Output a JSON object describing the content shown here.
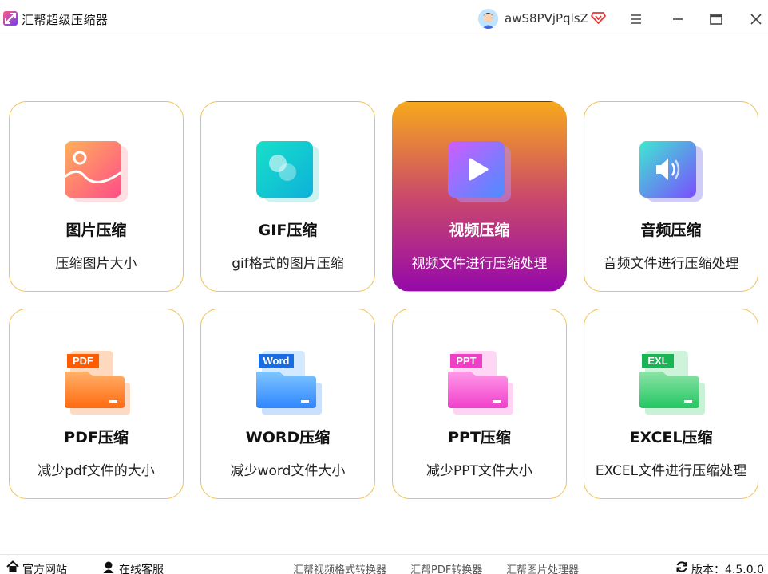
{
  "window": {
    "title": "汇帮超级压缩器",
    "username": "awS8PVjPqlsZ",
    "accent": "#f2c24f"
  },
  "cards": [
    {
      "title": "图片压缩",
      "desc": "压缩图片大小",
      "icon": "image-icon"
    },
    {
      "title": "GIF压缩",
      "desc": "gif格式的图片压缩",
      "icon": "gif-icon"
    },
    {
      "title": "视频压缩",
      "desc": "视频文件进行压缩处理",
      "icon": "video-play-icon",
      "selected": true
    },
    {
      "title": "音频压缩",
      "desc": "音频文件进行压缩处理",
      "icon": "speaker-icon"
    },
    {
      "title": "PDF压缩",
      "desc": "减少pdf文件的大小",
      "icon": "pdf-folder-icon",
      "tag": "PDF"
    },
    {
      "title": "WORD压缩",
      "desc": "减少word文件大小",
      "icon": "word-folder-icon",
      "tag": "Word"
    },
    {
      "title": "PPT压缩",
      "desc": "减少PPT文件大小",
      "icon": "ppt-folder-icon",
      "tag": "PPT"
    },
    {
      "title": "EXCEL压缩",
      "desc": "EXCEL文件进行压缩处理",
      "icon": "excel-folder-icon",
      "tag": "EXL"
    }
  ],
  "footer": {
    "website": "官方网站",
    "support": "在线客服",
    "links": [
      "汇帮视频格式转换器",
      "汇帮PDF转换器",
      "汇帮图片处理器"
    ],
    "version": "版本：4.5.0.0"
  }
}
